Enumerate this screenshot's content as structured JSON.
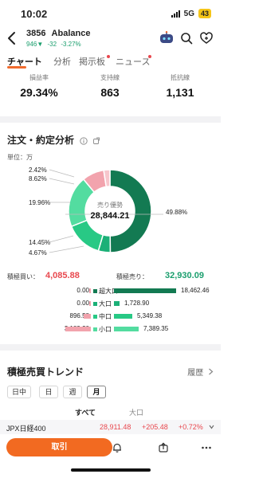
{
  "status_bar": {
    "time": "10:02",
    "network": "5G",
    "battery": "43"
  },
  "stock": {
    "code": "3856",
    "name": "Abalance",
    "price": "946",
    "arrow": "▼",
    "change": "-32",
    "change_pct": "-3.27%"
  },
  "tabs": [
    {
      "label": "チャート",
      "active": true
    },
    {
      "label": "分析",
      "active": false
    },
    {
      "label": "掲示板",
      "active": false
    },
    {
      "label": "ニュース",
      "active": false
    }
  ],
  "stats": [
    {
      "label": "損益率",
      "value": "29.34%"
    },
    {
      "label": "支持線",
      "value": "863"
    },
    {
      "label": "抵抗線",
      "value": "1,131"
    }
  ],
  "order_analysis": {
    "title": "注文・約定分析",
    "unit": "単位：万",
    "center_label": "売り優勢",
    "center_value": "28,844.21",
    "segments": [
      {
        "pct": 49.88,
        "label": "49.88%",
        "color": "#137a52"
      },
      {
        "pct": 4.67,
        "label": "4.67%",
        "color": "#1bb077"
      },
      {
        "pct": 14.45,
        "label": "14.45%",
        "color": "#28c985"
      },
      {
        "pct": 19.96,
        "label": "19.96%",
        "color": "#53dca0"
      },
      {
        "pct": 8.62,
        "label": "8.62%",
        "color": "#f2a3ad"
      },
      {
        "pct": 2.42,
        "label": "2.42%",
        "color": "#f7c6cc"
      }
    ],
    "buy_label": "積極買い：",
    "buy_total": "4,085.88",
    "sell_label": "積極売り：",
    "sell_total": "32,930.09",
    "flows": [
      {
        "category": "超大口",
        "buy": "0.00",
        "buy_value": 0,
        "sell": "18,462.46",
        "sell_value": 18462.46,
        "sell_color": "#137a52"
      },
      {
        "category": "大口",
        "buy": "0.00",
        "buy_value": 0,
        "sell": "1,728.90",
        "sell_value": 1728.9,
        "sell_color": "#1bb077"
      },
      {
        "category": "中口",
        "buy": "896.58",
        "buy_value": 896.58,
        "sell": "5,349.38",
        "sell_value": 5349.38,
        "sell_color": "#28c985"
      },
      {
        "category": "小口",
        "buy": "3,189.30",
        "buy_value": 3189.3,
        "sell": "7,389.35",
        "sell_value": 7389.35,
        "sell_color": "#53dca0"
      }
    ]
  },
  "trend": {
    "title": "積極売買トレンド",
    "more": "履歴",
    "periods": [
      {
        "label": "日中",
        "active": false
      },
      {
        "label": "日",
        "active": false
      },
      {
        "label": "週",
        "active": false
      },
      {
        "label": "月",
        "active": true
      }
    ],
    "col_all": "すべて",
    "col_large": "大口"
  },
  "ticker": {
    "name": "JPX日経400",
    "value": "28,911.48",
    "change": "+205.48",
    "change_pct": "+0.72%"
  },
  "bottom_bar": {
    "trade_label": "取引"
  }
}
